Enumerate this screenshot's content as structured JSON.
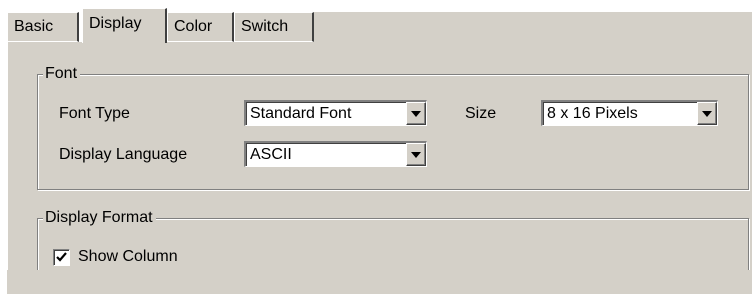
{
  "tabs": [
    {
      "label": "Basic",
      "active": false
    },
    {
      "label": "Display",
      "active": true
    },
    {
      "label": "Color",
      "active": false
    },
    {
      "label": "Switch",
      "active": false
    }
  ],
  "font_group": {
    "title": "Font",
    "font_type_label": "Font Type",
    "font_type_value": "Standard Font",
    "size_label": "Size",
    "size_value": "8 x 16 Pixels",
    "display_language_label": "Display Language",
    "display_language_value": "ASCII"
  },
  "display_format_group": {
    "title": "Display Format",
    "show_column_label": "Show Column",
    "show_column_checked": true
  },
  "colors": {
    "panel_background": "#d4d0c8",
    "field_background": "#ffffff",
    "shadow": "#808080"
  }
}
